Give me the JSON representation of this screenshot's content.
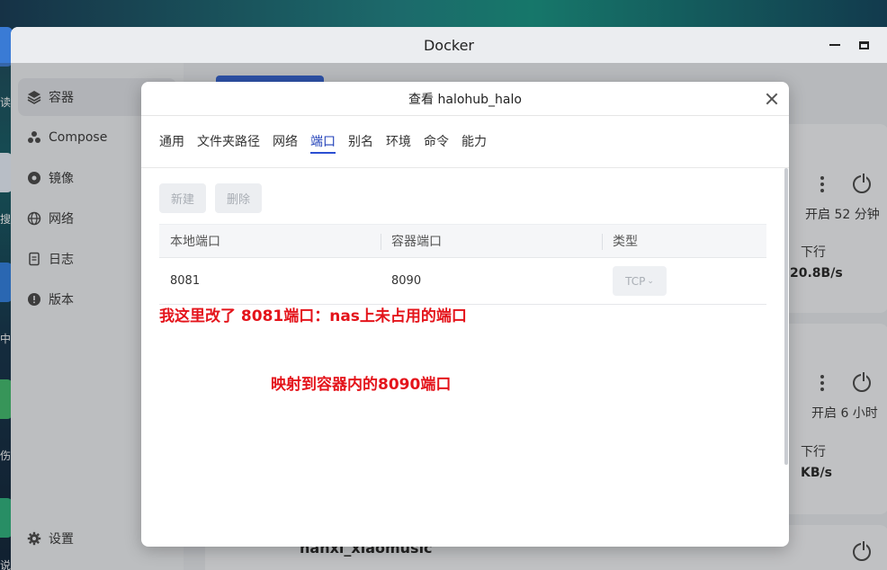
{
  "window": {
    "title": "Docker"
  },
  "sidebar": {
    "items": [
      {
        "label": "容器",
        "icon": "layers-icon",
        "active": true
      },
      {
        "label": "Compose",
        "icon": "compose-icon",
        "active": false
      },
      {
        "label": "镜像",
        "icon": "disc-icon",
        "active": false
      },
      {
        "label": "网络",
        "icon": "globe-icon",
        "active": false
      },
      {
        "label": "日志",
        "icon": "document-icon",
        "active": false
      },
      {
        "label": "版本",
        "icon": "info-icon",
        "active": false
      }
    ],
    "settings_label": "设置"
  },
  "background_cards": {
    "card1": {
      "uptime": "开启 52 分钟",
      "download_label": "下行",
      "download_rate": "20.8B/s"
    },
    "card2": {
      "uptime": "开启 6 小时",
      "download_label": "下行",
      "download_rate": "KB/s"
    },
    "card3": {
      "name": "hanxi_xiaomusic"
    }
  },
  "modal": {
    "title": "查看 halohub_halo",
    "tabs": [
      "通用",
      "文件夹路径",
      "网络",
      "端口",
      "别名",
      "环境",
      "命令",
      "能力"
    ],
    "active_tab": "端口",
    "buttons": {
      "new": "新建",
      "delete": "删除"
    },
    "table": {
      "headers": [
        "本地端口",
        "容器端口",
        "类型"
      ],
      "rows": [
        {
          "local": "8081",
          "container": "8090",
          "type": "TCP"
        }
      ]
    },
    "annotations": {
      "note1": "我这里改了 8081端口：nas上未占用的端口",
      "note2": "映射到容器内的8090端口"
    }
  },
  "desktop_chars": [
    "读",
    "搜",
    "中",
    "伤",
    "说"
  ]
}
